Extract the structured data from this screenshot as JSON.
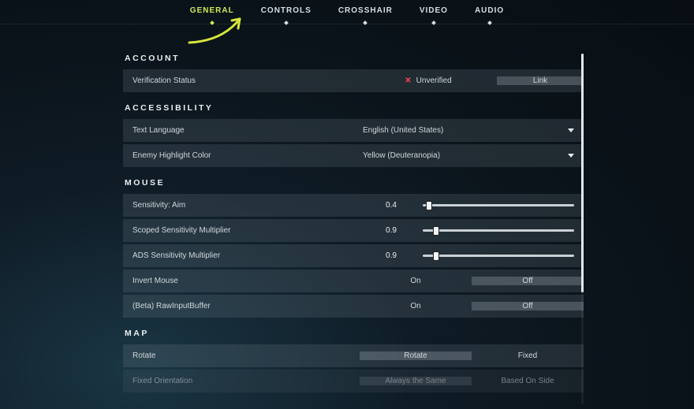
{
  "nav": {
    "tabs": [
      "GENERAL",
      "CONTROLS",
      "CROSSHAIR",
      "VIDEO",
      "AUDIO"
    ],
    "active_index": 0
  },
  "sections": {
    "account": {
      "title": "ACCOUNT",
      "verification_label": "Verification Status",
      "verification_value": "Unverified",
      "link_label": "Link"
    },
    "accessibility": {
      "title": "ACCESSIBILITY",
      "text_language": {
        "label": "Text Language",
        "value": "English (United States)"
      },
      "enemy_highlight": {
        "label": "Enemy Highlight Color",
        "value": "Yellow (Deuteranopia)"
      }
    },
    "mouse": {
      "title": "MOUSE",
      "sensitivity": {
        "label": "Sensitivity: Aim",
        "value": "0.4",
        "fraction": 0.04
      },
      "scoped": {
        "label": "Scoped Sensitivity Multiplier",
        "value": "0.9",
        "fraction": 0.09
      },
      "ads": {
        "label": "ADS Sensitivity Multiplier",
        "value": "0.9",
        "fraction": 0.09
      },
      "invert": {
        "label": "Invert Mouse",
        "on": "On",
        "off": "Off",
        "selected": "Off"
      },
      "raw": {
        "label": "(Beta) RawInputBuffer",
        "on": "On",
        "off": "Off",
        "selected": "Off"
      }
    },
    "map": {
      "title": "MAP",
      "rotate": {
        "label": "Rotate",
        "opt_a": "Rotate",
        "opt_b": "Fixed",
        "selected": "Rotate"
      },
      "fixed_orient": {
        "label": "Fixed Orientation",
        "opt_a": "Always the Same",
        "opt_b": "Based On Side",
        "selected": "Always the Same"
      }
    }
  },
  "colors": {
    "accent": "#cfe857",
    "danger": "#ff4655"
  }
}
